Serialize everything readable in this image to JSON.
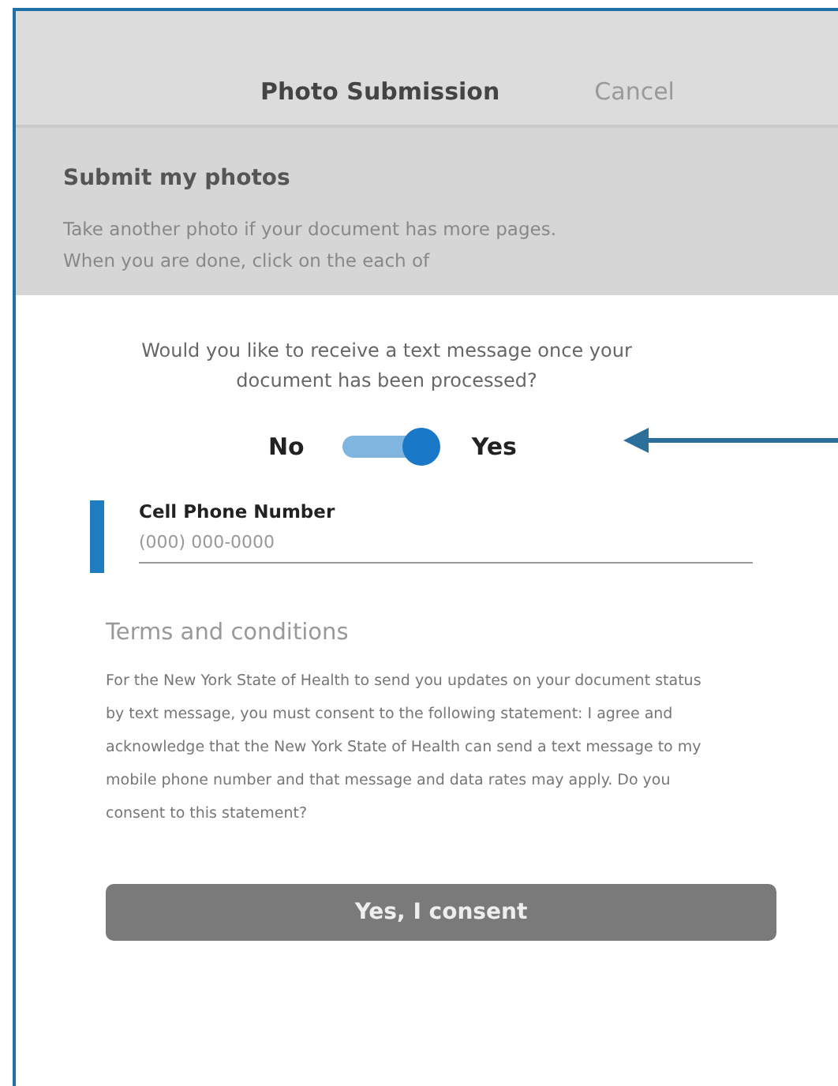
{
  "header": {
    "title": "Photo Submission",
    "cancel": "Cancel"
  },
  "background_panel": {
    "title": "Submit my photos",
    "text": "Take another photo if your document has more pages. When you are done, click on the each of"
  },
  "sheet": {
    "question": "Would you like to receive a text message once your document has been processed?",
    "toggle": {
      "off_label": "No",
      "on_label": "Yes",
      "on": true
    },
    "phone_field": {
      "label": "Cell Phone Number",
      "placeholder": "(000) 000-0000"
    },
    "terms_title": "Terms and conditions",
    "terms_text": "For the New York State of Health to send you updates on your document status by text message, you must consent to the following statement: I agree and acknowledge that the New York State of Health can send a text message to my mobile phone number and that message and data rates may apply. Do you consent to this statement?",
    "consent_button": "Yes, I consent"
  }
}
